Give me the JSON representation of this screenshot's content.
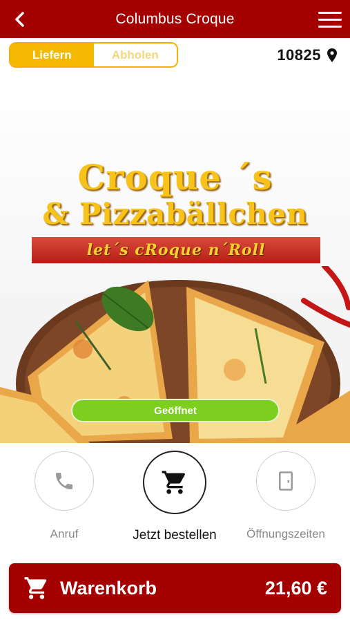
{
  "header": {
    "title": "Columbus Croque",
    "back_icon": "chevron-left-icon",
    "menu_icon": "hamburger-menu-icon"
  },
  "order_mode": {
    "options": [
      {
        "label": "Liefern",
        "active": true
      },
      {
        "label": "Abholen",
        "active": false
      }
    ]
  },
  "location": {
    "zip": "10825",
    "icon": "map-pin-icon"
  },
  "hero": {
    "logo_line1": "Croque ´s",
    "logo_line2": "& Pizzabällchen",
    "logo_slogan": "let´s cRoque n´Roll",
    "status_label": "Geöffnet",
    "status_color": "#7ccf1e"
  },
  "actions": [
    {
      "label": "Anruf",
      "icon": "phone-icon"
    },
    {
      "label": "Jetzt bestellen",
      "icon": "cart-icon"
    },
    {
      "label": "Öffnungszeiten",
      "icon": "door-icon"
    }
  ],
  "cart": {
    "label": "Warenkorb",
    "total": "21,60 €",
    "icon": "cart-icon"
  },
  "colors": {
    "brand": "#a40000",
    "accent": "#f5b800"
  }
}
